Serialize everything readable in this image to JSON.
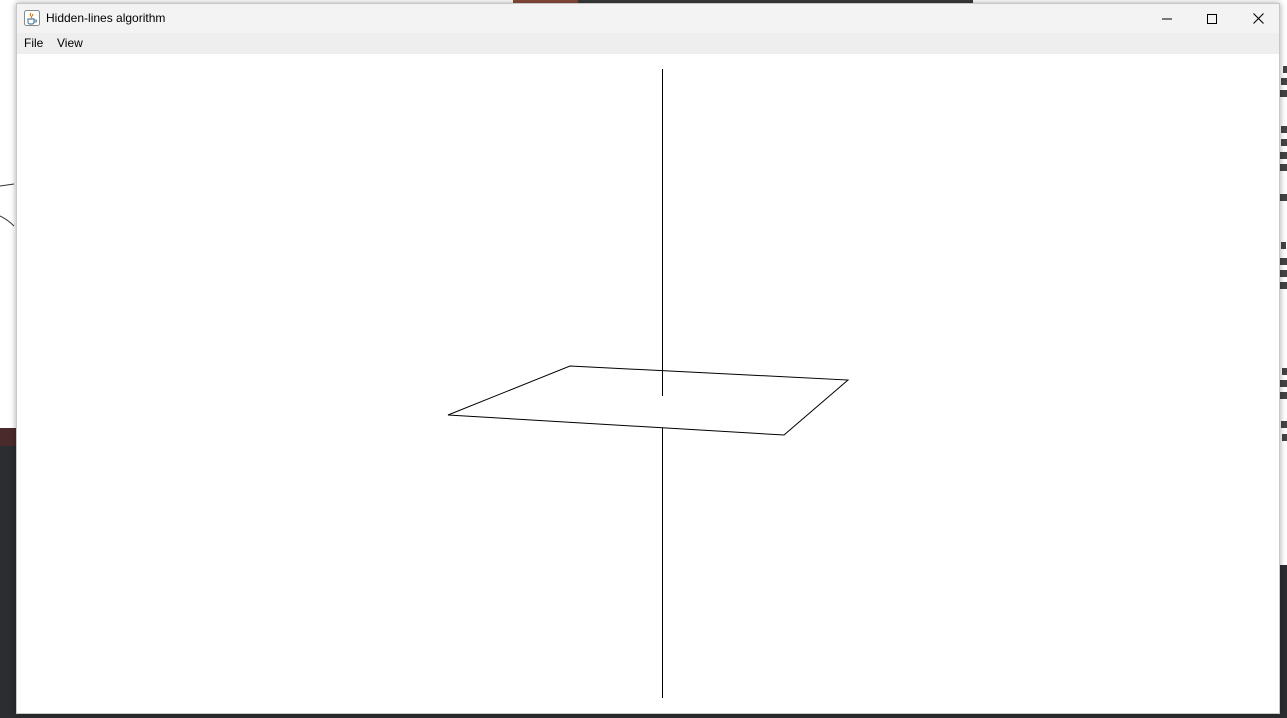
{
  "window": {
    "title": "Hidden-lines algorithm",
    "app_icon": "java-coffee-cup-icon"
  },
  "menubar": {
    "items": [
      {
        "label": "File"
      },
      {
        "label": "View"
      }
    ]
  },
  "title_controls": {
    "minimize_icon": "minimize-icon",
    "maximize_icon": "maximize-icon",
    "close_icon": "close-icon"
  },
  "canvas": {
    "background": "#ffffff",
    "stroke_color": "#000000",
    "scene": "vertical-line-through-planar-quadrilateral"
  }
}
